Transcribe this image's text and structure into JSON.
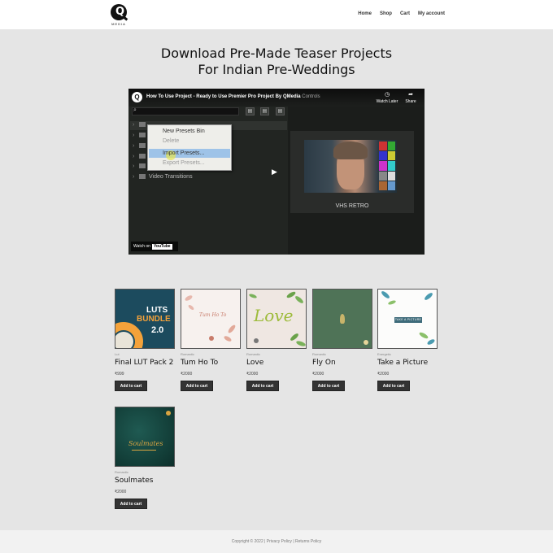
{
  "brand": {
    "logo_letter": "Q",
    "logo_text": "MEDIA"
  },
  "nav": {
    "items": [
      "Home",
      "Shop",
      "Cart",
      "My account"
    ]
  },
  "hero": {
    "line1": "Download Pre-Made Teaser Projects",
    "line2": "For Indian Pre-Weddings"
  },
  "video": {
    "logo_letter": "Q",
    "title": "How To Use Project - Ready to Use Premier Pro Project By QMedia",
    "title_suffix": "Controls",
    "watch_later": "Watch Later",
    "share": "Share",
    "tree_rows": [
      "",
      "",
      "",
      "",
      "",
      "Video Transitions"
    ],
    "context_menu": [
      "New Presets Bin",
      "Delete",
      "Import Presets...",
      "Export Presets..."
    ],
    "clip_label": "VHS RETRO",
    "watch_on": "Watch on",
    "youtube": "YouTube"
  },
  "products": [
    {
      "category": "Lut",
      "name": "Final LUT Pack 2",
      "price": "₹999",
      "button": "Add to cart",
      "art": {
        "line1": "LUTS",
        "line2": "BUNDLE",
        "line3": "2.0"
      }
    },
    {
      "category": "Romantic",
      "name": "Tum Ho To",
      "price": "₹2000",
      "button": "Add to cart",
      "art": {
        "script": "Tum Ho To"
      }
    },
    {
      "category": "Romantic",
      "name": "Love",
      "price": "₹2000",
      "button": "Add to cart",
      "art": {
        "script": "Love"
      }
    },
    {
      "category": "Romantic",
      "name": "Fly On",
      "price": "₹2000",
      "button": "Add to cart"
    },
    {
      "category": "Energetic",
      "name": "Take a Picture",
      "price": "₹2000",
      "button": "Add to cart",
      "art": {
        "banner": "TAKE A PICTURE"
      }
    },
    {
      "category": "Romantic",
      "name": "Soulmates",
      "price": "₹2000",
      "button": "Add to cart",
      "art": {
        "script": "Soulmates"
      }
    }
  ],
  "footer": {
    "text": "Copyright © 2022 | Privacy Policy | Returns Policy"
  },
  "colors": {
    "page_bg": "#e5e5e5",
    "header_bg": "#ffffff",
    "button_bg": "#333333",
    "footer_bg": "#f2f2f2"
  }
}
